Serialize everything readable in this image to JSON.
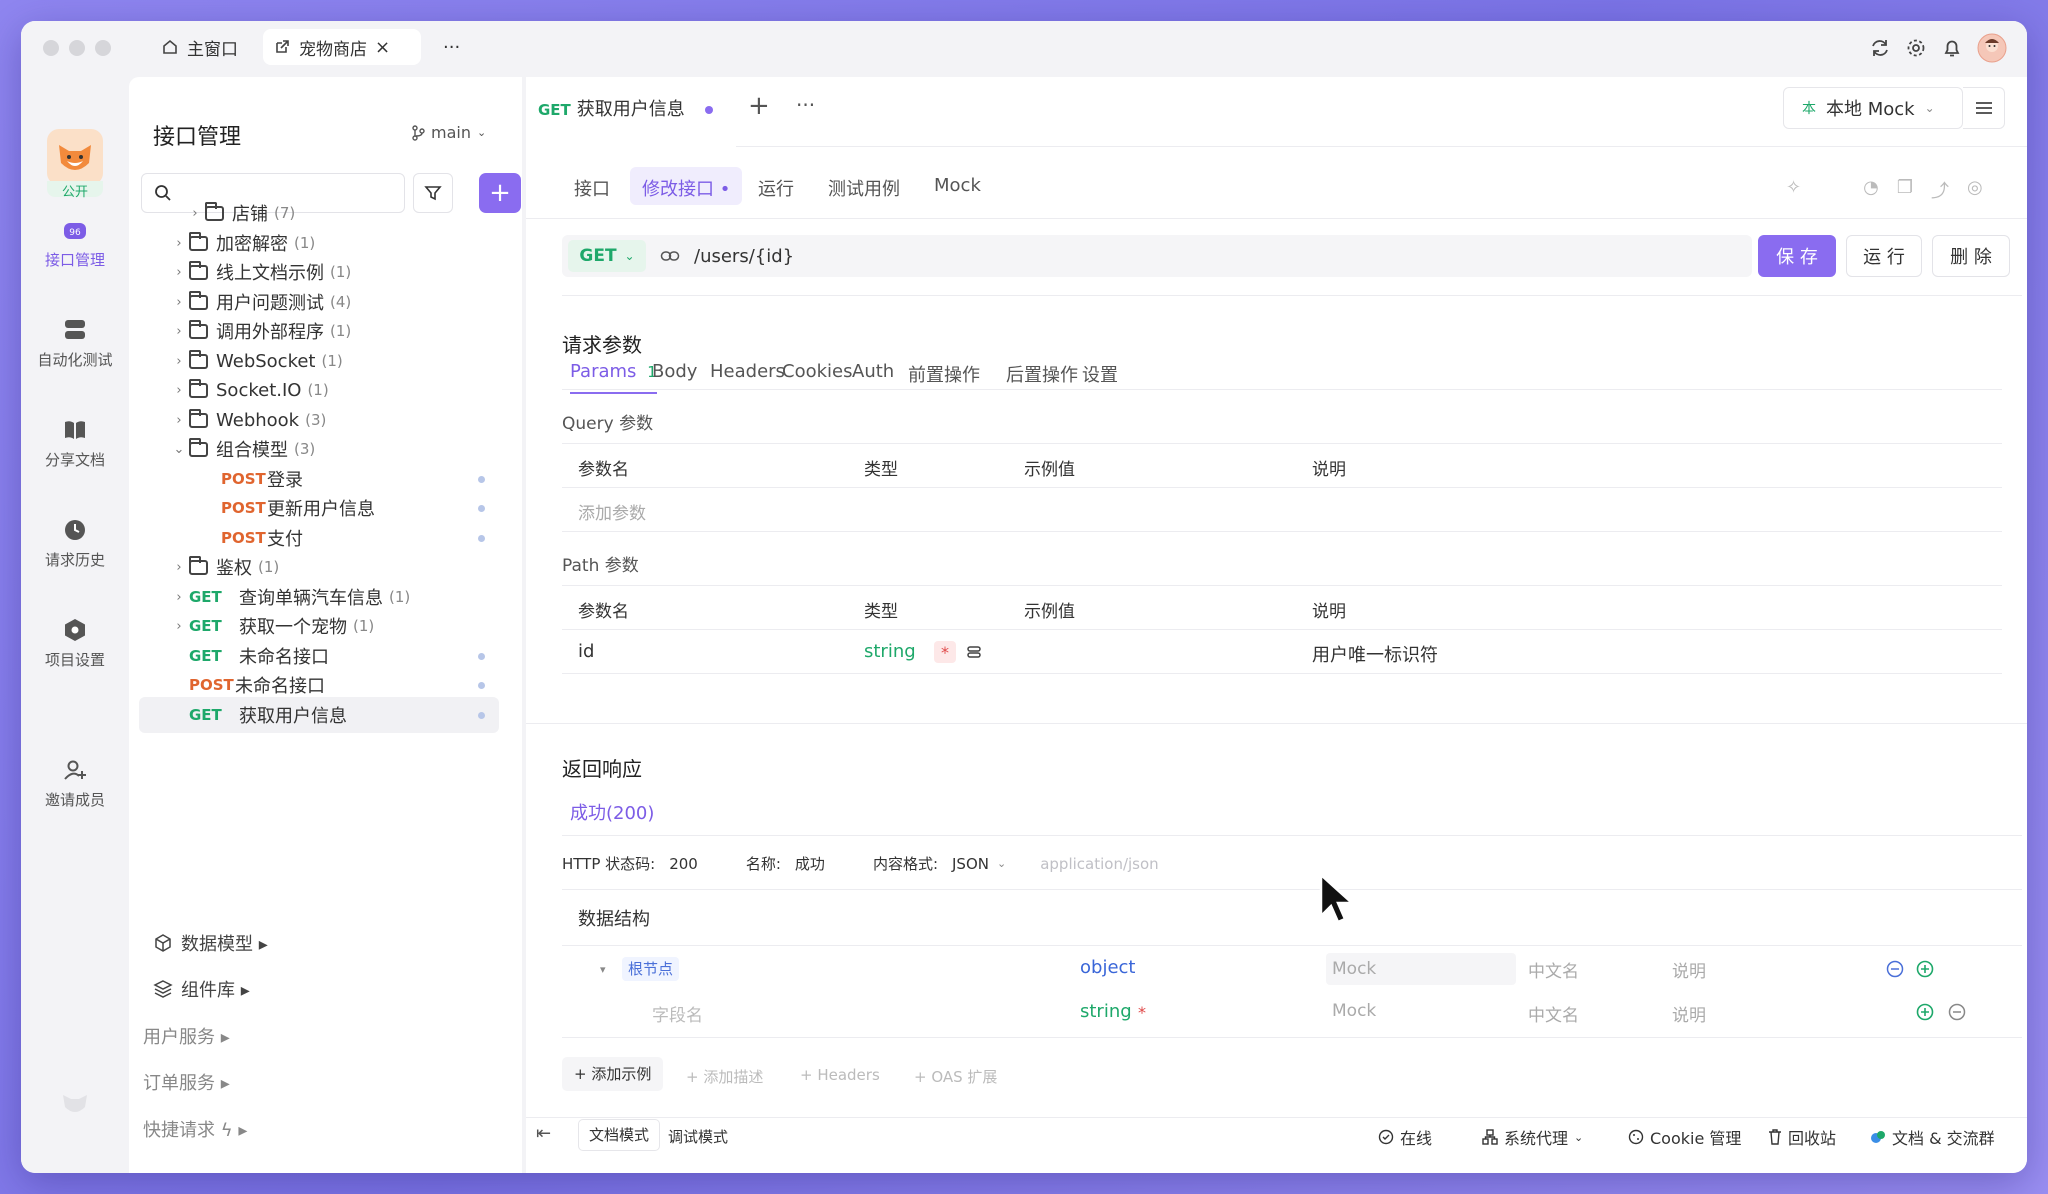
{
  "titlebar": {
    "tabs": [
      {
        "label": "主窗口"
      },
      {
        "label": "宠物商店"
      }
    ],
    "more": "···"
  },
  "rail": {
    "badge": "公开",
    "items": [
      {
        "label": "接口管理"
      },
      {
        "label": "自动化测试"
      },
      {
        "label": "分享文档"
      },
      {
        "label": "请求历史"
      },
      {
        "label": "项目设置"
      },
      {
        "label": "邀请成员"
      }
    ]
  },
  "panel": {
    "title": "接口管理",
    "branch": "main",
    "search_placeholder": "",
    "tree": [
      {
        "kind": "folder",
        "label": "店铺",
        "count": "(7)",
        "indent": 1,
        "open": false
      },
      {
        "kind": "folder",
        "label": "加密解密",
        "count": "(1)",
        "indent": 0,
        "open": false
      },
      {
        "kind": "folder",
        "label": "线上文档示例",
        "count": "(1)",
        "indent": 0,
        "open": false
      },
      {
        "kind": "folder",
        "label": "用户问题测试",
        "count": "(4)",
        "indent": 0,
        "open": false
      },
      {
        "kind": "folder",
        "label": "调用外部程序",
        "count": "(1)",
        "indent": 0,
        "open": false
      },
      {
        "kind": "folder",
        "label": "WebSocket",
        "count": "(1)",
        "indent": 0,
        "open": false
      },
      {
        "kind": "folder",
        "label": "Socket.IO",
        "count": "(1)",
        "indent": 0,
        "open": false
      },
      {
        "kind": "folder",
        "label": "Webhook",
        "count": "(3)",
        "indent": 0,
        "open": false
      },
      {
        "kind": "folder",
        "label": "组合模型",
        "count": "(3)",
        "indent": 0,
        "open": true
      },
      {
        "kind": "api",
        "method": "POST",
        "label": "登录",
        "indent": 1,
        "dot": true
      },
      {
        "kind": "api",
        "method": "POST",
        "label": "更新用户信息",
        "indent": 1,
        "dot": true
      },
      {
        "kind": "api",
        "method": "POST",
        "label": "支付",
        "indent": 1,
        "dot": true
      },
      {
        "kind": "folder",
        "label": "鉴权",
        "count": "(1)",
        "indent": 0,
        "open": false
      },
      {
        "kind": "apigroup",
        "method": "GET",
        "label": "查询单辆汽车信息",
        "count": "(1)",
        "indent": 0
      },
      {
        "kind": "apigroup",
        "method": "GET",
        "label": "获取一个宠物",
        "count": "(1)",
        "indent": 0
      },
      {
        "kind": "api",
        "method": "GET",
        "label": "未命名接口",
        "indent": 0,
        "dot": true
      },
      {
        "kind": "api",
        "method": "POST",
        "label": "未命名接口",
        "indent": 0,
        "dot": true
      },
      {
        "kind": "api",
        "method": "GET",
        "label": "获取用户信息",
        "indent": 0,
        "dot": true,
        "selected": true
      }
    ],
    "sections": [
      {
        "label": "数据模型 ▸"
      },
      {
        "label": "组件库 ▸"
      },
      {
        "label": "用户服务 ▸"
      },
      {
        "label": "订单服务 ▸"
      },
      {
        "label": "快捷请求 ϟ ▸"
      }
    ]
  },
  "main": {
    "doc_tab": {
      "method": "GET",
      "title": "获取用户信息"
    },
    "env": "本地 Mock",
    "subtabs": [
      "接口",
      "修改接口 •",
      "运行",
      "测试用例",
      "Mock"
    ],
    "url": {
      "method": "GET",
      "path": "/users/{id}"
    },
    "actions": {
      "save": "保 存",
      "run": "运 行",
      "delete": "删 除"
    },
    "request": {
      "title": "请求参数",
      "tabs": [
        "Params",
        "Body",
        "Headers",
        "Cookies",
        "Auth",
        "前置操作",
        "后置操作",
        "设置"
      ],
      "params_count": "1",
      "query_label": "Query 参数",
      "path_label": "Path 参数",
      "columns": [
        "参数名",
        "类型",
        "示例值",
        "说明"
      ],
      "add_param": "添加参数",
      "path_row": {
        "name": "id",
        "type": "string",
        "required": "*",
        "desc": "用户唯一标识符"
      }
    },
    "response": {
      "title": "返回响应",
      "tab": "成功(200)",
      "status_label": "HTTP 状态码:",
      "status": "200",
      "name_label": "名称:",
      "name": "成功",
      "format_label": "内容格式:",
      "format": "JSON",
      "mime": "application/json",
      "schema_title": "数据结构",
      "root": {
        "name": "根节点",
        "type": "object",
        "mock": "Mock",
        "cn": "中文名",
        "desc": "说明"
      },
      "field": {
        "name": "字段名",
        "type": "string",
        "required": "*",
        "mock": "Mock",
        "cn": "中文名",
        "desc": "说明"
      },
      "extras": [
        "+ 添加示例",
        "+ 添加描述",
        "+ Headers",
        "+ OAS 扩展"
      ]
    },
    "bottom": {
      "modes": [
        "文档模式",
        "调试模式"
      ],
      "status": [
        "在线",
        "系统代理",
        "Cookie 管理",
        "回收站",
        "文档 & 交流群"
      ]
    }
  },
  "colors": {
    "accent": "#8a6cf0",
    "get": "#1ea86a",
    "post": "#e0652f"
  }
}
